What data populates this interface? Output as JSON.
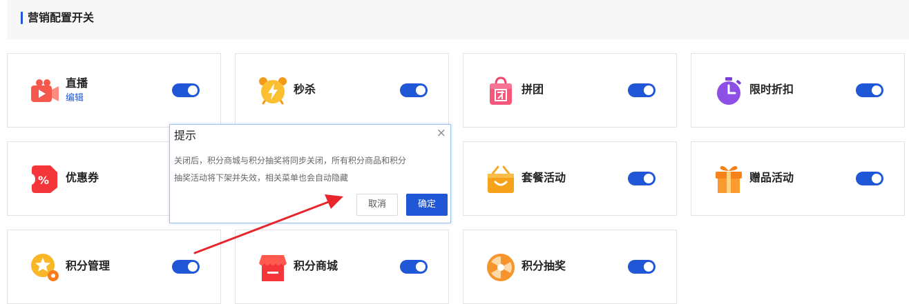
{
  "section": {
    "title": "营销配置开关"
  },
  "cards": {
    "live": {
      "label": "直播",
      "link": "编辑",
      "enabled": true
    },
    "seckill": {
      "label": "秒杀",
      "enabled": true
    },
    "group": {
      "label": "拼团",
      "enabled": true
    },
    "limited": {
      "label": "限时折扣",
      "enabled": true
    },
    "coupon": {
      "label": "优惠券",
      "enabled": true
    },
    "package": {
      "label": "套餐活动",
      "enabled": true
    },
    "gift": {
      "label": "赠品活动",
      "enabled": true
    },
    "points_manage": {
      "label": "积分管理",
      "enabled": true
    },
    "points_mall": {
      "label": "积分商城",
      "enabled": true
    },
    "points_lottery": {
      "label": "积分抽奖",
      "enabled": true
    }
  },
  "dialog": {
    "title": "提示",
    "close": "×",
    "body_line1": "关闭后，积分商城与积分抽奖将同步关闭，所有积分商品和积分",
    "body_line2": "抽奖活动将下架并失效，相关菜单也会自动隐藏",
    "cancel": "取消",
    "confirm": "确定"
  },
  "colors": {
    "accent": "#1f57d6",
    "arrow": "#e8252b"
  }
}
